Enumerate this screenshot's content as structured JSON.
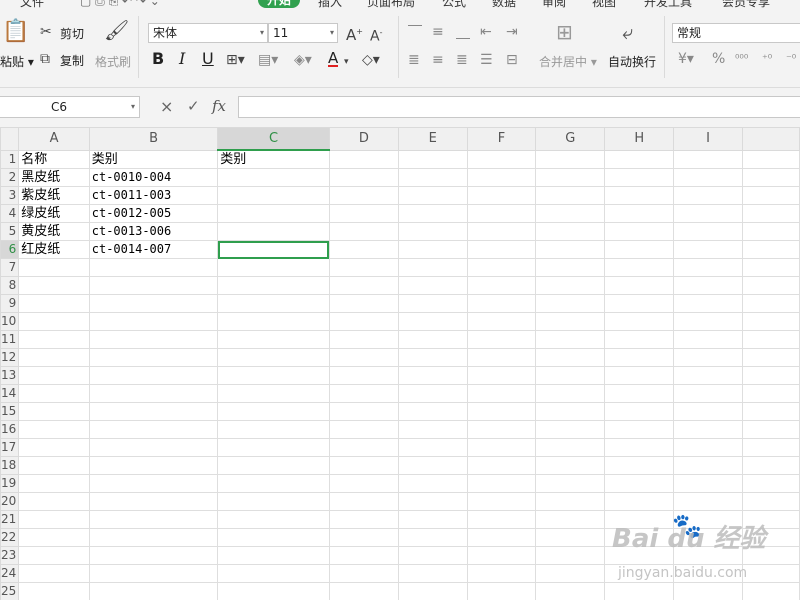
{
  "menu": {
    "items": [
      {
        "label": "文件",
        "active": false
      },
      {
        "label": "开始",
        "active": true
      },
      {
        "label": "插入",
        "active": false
      },
      {
        "label": "页面布局",
        "active": false
      },
      {
        "label": "公式",
        "active": false
      },
      {
        "label": "数据",
        "active": false
      },
      {
        "label": "审阅",
        "active": false
      },
      {
        "label": "视图",
        "active": false
      },
      {
        "label": "开发工具",
        "active": false
      },
      {
        "label": "会员专享",
        "active": false
      }
    ]
  },
  "ribbon": {
    "paste_label": "粘贴",
    "cut_label": "剪切",
    "copy_label": "复制",
    "format_painter_label": "格式刷",
    "font_name": "宋体",
    "font_size": "11",
    "merge_center_label": "合并居中",
    "wrap_text_label": "自动换行",
    "number_format": "常规",
    "bold_label": "B",
    "italic_label": "I",
    "underline_label": "U",
    "percent_label": "%",
    "currency_label": "¥"
  },
  "formula_bar": {
    "cell_ref": "C6",
    "cancel_icon": "×",
    "confirm_icon": "✓",
    "fx_label": "fx",
    "value": ""
  },
  "sheet": {
    "columns": [
      "A",
      "B",
      "C",
      "D",
      "E",
      "F",
      "G",
      "H",
      "I",
      ""
    ],
    "selected_column": "C",
    "selected_row": 6,
    "selected_cell": "C6",
    "rows": [
      {
        "num": "1",
        "cells": [
          "名称",
          "类别",
          "类别",
          "",
          "",
          "",
          "",
          "",
          "",
          ""
        ]
      },
      {
        "num": "2",
        "cells": [
          "黑皮纸",
          "ct-0010-004",
          "",
          "",
          "",
          "",
          "",
          "",
          "",
          ""
        ]
      },
      {
        "num": "3",
        "cells": [
          "紫皮纸",
          "ct-0011-003",
          "",
          "",
          "",
          "",
          "",
          "",
          "",
          ""
        ]
      },
      {
        "num": "4",
        "cells": [
          "绿皮纸",
          "ct-0012-005",
          "",
          "",
          "",
          "",
          "",
          "",
          "",
          ""
        ]
      },
      {
        "num": "5",
        "cells": [
          "黄皮纸",
          "ct-0013-006",
          "",
          "",
          "",
          "",
          "",
          "",
          "",
          ""
        ]
      },
      {
        "num": "6",
        "cells": [
          "红皮纸",
          "ct-0014-007",
          "",
          "",
          "",
          "",
          "",
          "",
          "",
          ""
        ]
      },
      {
        "num": "7",
        "cells": [
          "",
          "",
          "",
          "",
          "",
          "",
          "",
          "",
          "",
          ""
        ]
      },
      {
        "num": "8",
        "cells": [
          "",
          "",
          "",
          "",
          "",
          "",
          "",
          "",
          "",
          ""
        ]
      },
      {
        "num": "9",
        "cells": [
          "",
          "",
          "",
          "",
          "",
          "",
          "",
          "",
          "",
          ""
        ]
      },
      {
        "num": "10",
        "cells": [
          "",
          "",
          "",
          "",
          "",
          "",
          "",
          "",
          "",
          ""
        ]
      },
      {
        "num": "11",
        "cells": [
          "",
          "",
          "",
          "",
          "",
          "",
          "",
          "",
          "",
          ""
        ]
      },
      {
        "num": "12",
        "cells": [
          "",
          "",
          "",
          "",
          "",
          "",
          "",
          "",
          "",
          ""
        ]
      },
      {
        "num": "13",
        "cells": [
          "",
          "",
          "",
          "",
          "",
          "",
          "",
          "",
          "",
          ""
        ]
      },
      {
        "num": "14",
        "cells": [
          "",
          "",
          "",
          "",
          "",
          "",
          "",
          "",
          "",
          ""
        ]
      },
      {
        "num": "15",
        "cells": [
          "",
          "",
          "",
          "",
          "",
          "",
          "",
          "",
          "",
          ""
        ]
      },
      {
        "num": "16",
        "cells": [
          "",
          "",
          "",
          "",
          "",
          "",
          "",
          "",
          "",
          ""
        ]
      },
      {
        "num": "17",
        "cells": [
          "",
          "",
          "",
          "",
          "",
          "",
          "",
          "",
          "",
          ""
        ]
      },
      {
        "num": "18",
        "cells": [
          "",
          "",
          "",
          "",
          "",
          "",
          "",
          "",
          "",
          ""
        ]
      },
      {
        "num": "19",
        "cells": [
          "",
          "",
          "",
          "",
          "",
          "",
          "",
          "",
          "",
          ""
        ]
      },
      {
        "num": "20",
        "cells": [
          "",
          "",
          "",
          "",
          "",
          "",
          "",
          "",
          "",
          ""
        ]
      },
      {
        "num": "21",
        "cells": [
          "",
          "",
          "",
          "",
          "",
          "",
          "",
          "",
          "",
          ""
        ]
      },
      {
        "num": "22",
        "cells": [
          "",
          "",
          "",
          "",
          "",
          "",
          "",
          "",
          "",
          ""
        ]
      },
      {
        "num": "23",
        "cells": [
          "",
          "",
          "",
          "",
          "",
          "",
          "",
          "",
          "",
          ""
        ]
      },
      {
        "num": "24",
        "cells": [
          "",
          "",
          "",
          "",
          "",
          "",
          "",
          "",
          "",
          ""
        ]
      },
      {
        "num": "25",
        "cells": [
          "",
          "",
          "",
          "",
          "",
          "",
          "",
          "",
          "",
          ""
        ]
      }
    ]
  },
  "watermark": {
    "brand": "Bai du 经验",
    "url": "jingyan.baidu.com"
  },
  "colors": {
    "accent_green": "#2f9e4d",
    "menu_active_bg": "#31a14f",
    "ribbon_bg": "#f3f3f3",
    "font_color_red": "#e02020"
  }
}
